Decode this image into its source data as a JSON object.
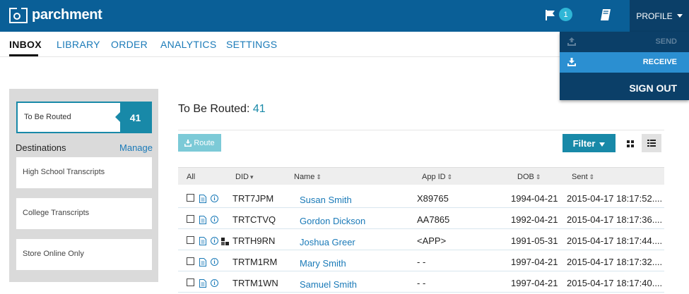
{
  "header": {
    "brand": "parchment",
    "notification_count": "1",
    "profile_label": "PROFILE"
  },
  "nav": {
    "tabs": [
      {
        "label": "INBOX"
      },
      {
        "label": "LIBRARY"
      },
      {
        "label": "ORDER"
      },
      {
        "label": "ANALYTICS"
      },
      {
        "label": "SETTINGS"
      }
    ]
  },
  "profile_menu": {
    "send": "SEND",
    "receive": "RECEIVE",
    "sign_out": "SIGN OUT"
  },
  "sidebar": {
    "routed_label": "To Be Routed",
    "routed_count": "41",
    "destinations_title": "Destinations",
    "manage_label": "Manage",
    "destinations": [
      {
        "label": "High School Transcripts"
      },
      {
        "label": "College Transcripts"
      },
      {
        "label": "Store Online Only"
      }
    ]
  },
  "main": {
    "title_prefix": "To Be Routed:",
    "title_count": "41",
    "route_label": "Route",
    "filter_label": "Filter"
  },
  "table": {
    "headers": {
      "all": "All",
      "did": "DID",
      "name": "Name",
      "app_id": "App ID",
      "dob": "DOB",
      "sent": "Sent"
    },
    "rows": [
      {
        "did": "TRT7JPM",
        "name": "Susan Smith",
        "app_id": "X89765",
        "dob": "1994-04-21",
        "sent": "2015-04-17 18:17:52...."
      },
      {
        "did": "TRTCTVQ",
        "name": "Gordon Dickson",
        "app_id": "AA7865",
        "dob": "1992-04-21",
        "sent": "2015-04-17 18:17:36...."
      },
      {
        "did": "TRTH9RN",
        "name": "Joshua Greer",
        "app_id": "<APP>",
        "dob": "1991-05-31",
        "sent": "2015-04-17 18:17:44...."
      },
      {
        "did": "TRTM1RM",
        "name": "Mary Smith",
        "app_id": "- -",
        "dob": "1997-04-21",
        "sent": "2015-04-17 18:17:32...."
      },
      {
        "did": "TRTM1WN",
        "name": "Samuel Smith",
        "app_id": "- -",
        "dob": "1997-04-21",
        "sent": "2015-04-17 18:17:40...."
      }
    ]
  },
  "icons": {
    "flag": "flag-icon",
    "book": "book-icon",
    "send": "upload-tray-icon",
    "receive": "download-tray-icon",
    "route": "download-icon",
    "grid": "grid-view-icon",
    "list": "list-view-icon",
    "document": "document-icon",
    "info": "info-icon",
    "squares": "squares-icon"
  },
  "colors": {
    "header_bg": "#0a5f97",
    "profile_bg": "#0b3f68",
    "accent": "#1889a8",
    "receive_highlight": "#2b8fd1",
    "link": "#1a7ab8",
    "badge": "#2fb6d6"
  }
}
